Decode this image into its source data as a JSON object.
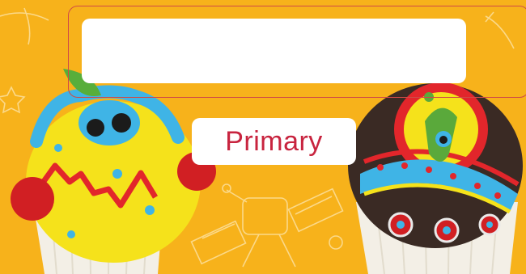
{
  "hero": {
    "background_color": "#f7b21b",
    "accent_color": "#c8243f",
    "decorations": [
      "alien-cupcake",
      "spaceship-cupcake",
      "satellite-doodle",
      "star-doodles"
    ]
  },
  "search": {
    "value": "",
    "placeholder": ""
  },
  "primary_button": {
    "label": "Primary"
  }
}
